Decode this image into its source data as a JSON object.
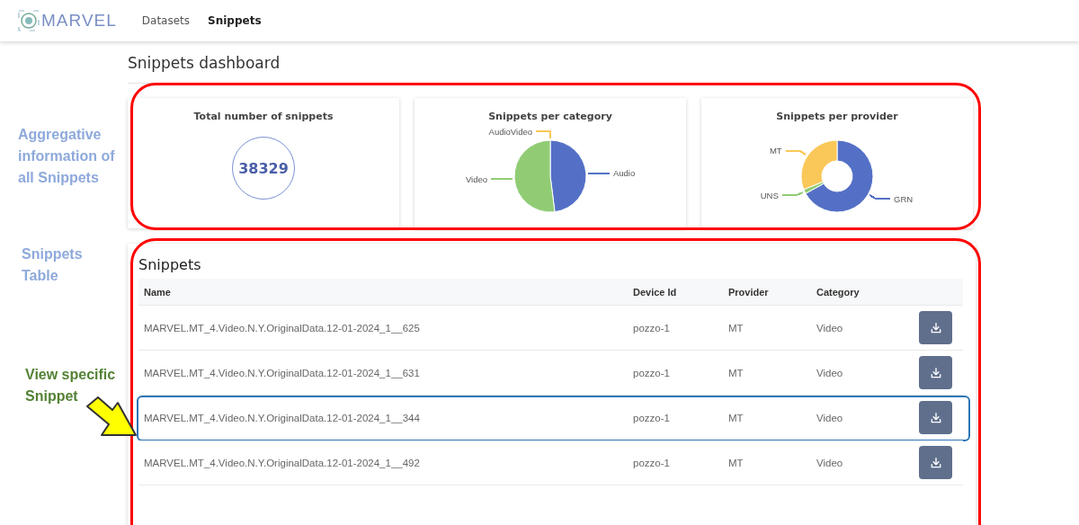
{
  "header": {
    "logo": "MARVEL",
    "nav": [
      {
        "label": "Datasets",
        "selected": false
      },
      {
        "label": "Snippets",
        "selected": true
      }
    ]
  },
  "page_title": "Snippets dashboard",
  "cards": [
    {
      "kind": "counter",
      "title": "Total number of snippets",
      "value": "38329"
    },
    {
      "kind": "pie",
      "title": "Snippets per category",
      "slices": [
        {
          "label": "Audio",
          "color": "#5470c6"
        },
        {
          "label": "Video",
          "color": "#91cc75"
        },
        {
          "label": "AudioVideo",
          "color": "#fac858"
        }
      ]
    },
    {
      "kind": "donut",
      "title": "Snippets per provider",
      "slices": [
        {
          "label": "GRN",
          "color": "#5470c6"
        },
        {
          "label": "UNS",
          "color": "#91cc75"
        },
        {
          "label": "MT",
          "color": "#fac858"
        }
      ]
    }
  ],
  "table": {
    "title": "Snippets",
    "columns": [
      "Name",
      "Device Id",
      "Provider",
      "Category"
    ],
    "rows": [
      {
        "name": "MARVEL.MT_4.Video.N.Y.OriginalData.12-01-2024_1__625",
        "device_id": "pozzo-1",
        "provider": "MT",
        "category": "Video",
        "selected": false
      },
      {
        "name": "MARVEL.MT_4.Video.N.Y.OriginalData.12-01-2024_1__631",
        "device_id": "pozzo-1",
        "provider": "MT",
        "category": "Video",
        "selected": false
      },
      {
        "name": "MARVEL.MT_4.Video.N.Y.OriginalData.12-01-2024_1__344",
        "device_id": "pozzo-1",
        "provider": "MT",
        "category": "Video",
        "selected": true
      },
      {
        "name": "MARVEL.MT_4.Video.N.Y.OriginalData.12-01-2024_1__492",
        "device_id": "pozzo-1",
        "provider": "MT",
        "category": "Video",
        "selected": false
      }
    ]
  },
  "annotations": {
    "aggregate_label": "Aggregative information of all Snippets",
    "table_label": "Snippets Table",
    "row_label": "View specific Snippet"
  }
}
